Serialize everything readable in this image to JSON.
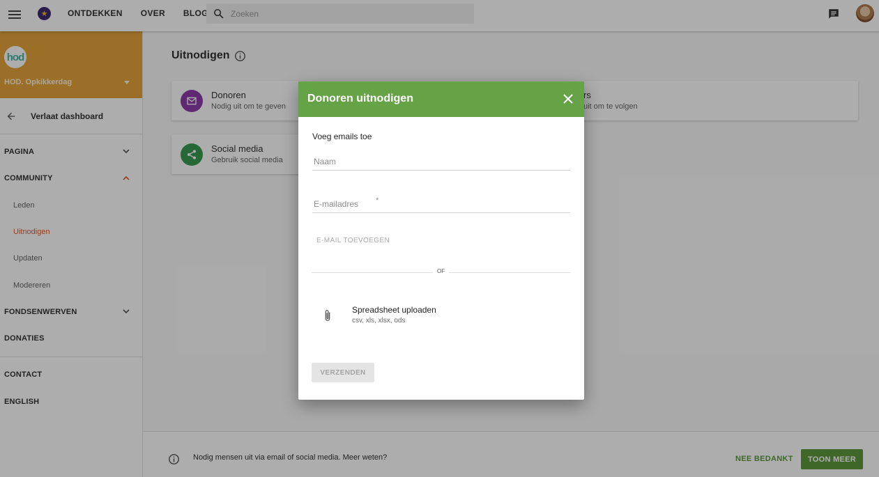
{
  "topbar": {
    "nav": [
      "ONTDEKKEN",
      "OVER",
      "BLOG"
    ],
    "search_placeholder": "Zoeken"
  },
  "sidebar": {
    "org_logo_text": "hod",
    "org_name": "HOD. Opkikkerdag",
    "back_label": "Verlaat dashboard",
    "sections": {
      "pagina": "PAGINA",
      "community": "COMMUNITY",
      "leden": "Leden",
      "uitnodigen": "Uitnodigen",
      "updaten": "Updaten",
      "modereren": "Modereren",
      "fondsenwerven": "FONDSENWERVEN",
      "donaties": "DONATIES",
      "contact": "CONTACT",
      "english": "ENGLISH"
    }
  },
  "main": {
    "title": "Uitnodigen",
    "cards": {
      "donoren_title": "Donoren",
      "donoren_sub": "Nodig uit om te geven",
      "volgers_title": "rs",
      "volgers_sub": "uit om te volgen",
      "social_title": "Social media",
      "social_sub": "Gebruik social media"
    }
  },
  "banner": {
    "text": "Nodig mensen uit via email of social media. Meer weten?",
    "dismiss_label": "NEE BEDANKT",
    "more_label": "TOON MEER"
  },
  "dialog": {
    "title": "Donoren uitnodigen",
    "section_label": "Voeg emails toe",
    "name_placeholder": "Naam",
    "email_placeholder": "E-mailadres",
    "required_mark": "*",
    "add_email_label": "E-MAIL TOEVOEGEN",
    "or_label": "OF",
    "upload_title": "Spreadsheet uploaden",
    "upload_formats": "csv, xls, xlsx, ods",
    "send_label": "VERZENDEN"
  },
  "colors": {
    "dialog_header": "#66a346",
    "sidebar_header": "#e5a43a",
    "active_nav": "#e05a2a",
    "donoren_circle": "#8e3aa8",
    "social_circle": "#3a9a52",
    "primary_button": "#5d9a3c"
  }
}
